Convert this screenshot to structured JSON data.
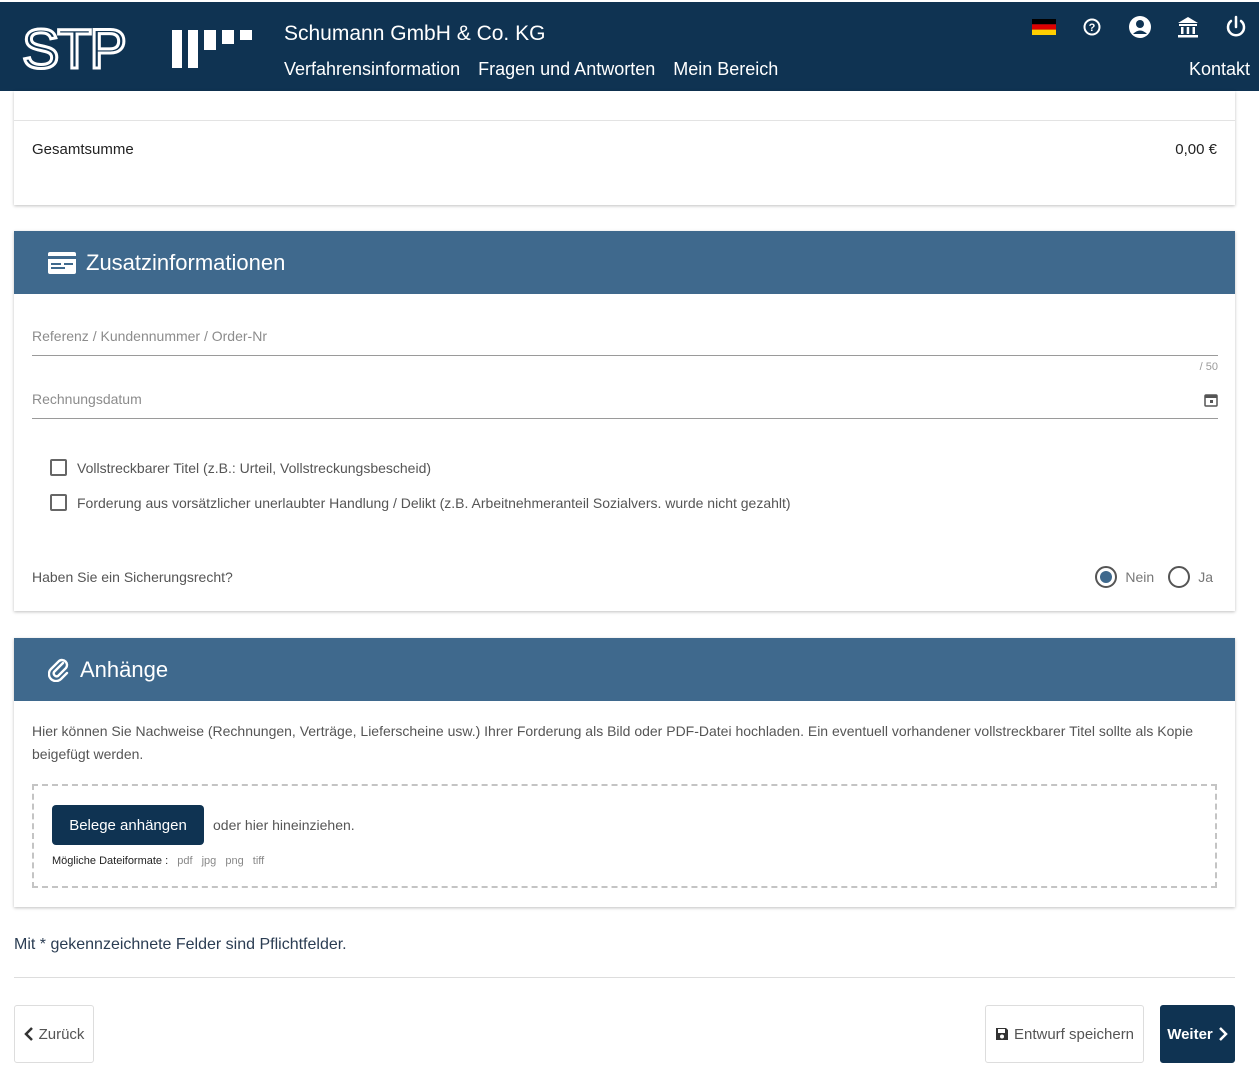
{
  "header": {
    "company": "Schumann GmbH & Co. KG",
    "nav": [
      "Verfahrensinformation",
      "Fragen und Antworten",
      "Mein Bereich"
    ],
    "contact": "Kontakt",
    "logo_text": "STP",
    "icons": [
      "german-flag-icon",
      "help-icon",
      "user-icon",
      "bank-icon",
      "power-icon"
    ]
  },
  "summary": {
    "label": "Gesamtsumme",
    "value": "0,00 €"
  },
  "zusatz": {
    "title": "Zusatzinformationen",
    "reference_placeholder": "Referenz / Kundennummer / Order-Nr",
    "reference_counter": "/ 50",
    "date_placeholder": "Rechnungsdatum",
    "checkbox_1": "Vollstreckbarer Titel (z.B.: Urteil, Vollstreckungsbescheid)",
    "checkbox_2": "Forderung aus vorsätzlicher unerlaubter Handlung / Delikt (z.B. Arbeitnehmeranteil Sozialvers. wurde nicht gezahlt)",
    "question": "Haben Sie ein Sicherungsrecht?",
    "radio_no": "Nein",
    "radio_yes": "Ja",
    "selected": "Nein"
  },
  "attachments": {
    "title": "Anhänge",
    "description": "Hier können Sie Nachweise (Rechnungen, Verträge, Lieferscheine usw.) Ihrer Forderung als Bild oder PDF-Datei hochladen. Ein eventuell vorhandener vollstreckbarer Titel sollte als Kopie beigefügt werden.",
    "button": "Belege anhängen",
    "drag_text": "oder hier hineinziehen.",
    "formats_label": "Mögliche Dateiformate :",
    "formats": [
      "pdf",
      "jpg",
      "png",
      "tiff"
    ]
  },
  "footer": {
    "required_note": "Mit * gekennzeichnete Felder sind Pflichtfelder.",
    "back": "Zurück",
    "draft": "Entwurf speichern",
    "next": "Weiter"
  },
  "colors": {
    "navy": "#0f3352",
    "section_header": "#3f698d"
  }
}
